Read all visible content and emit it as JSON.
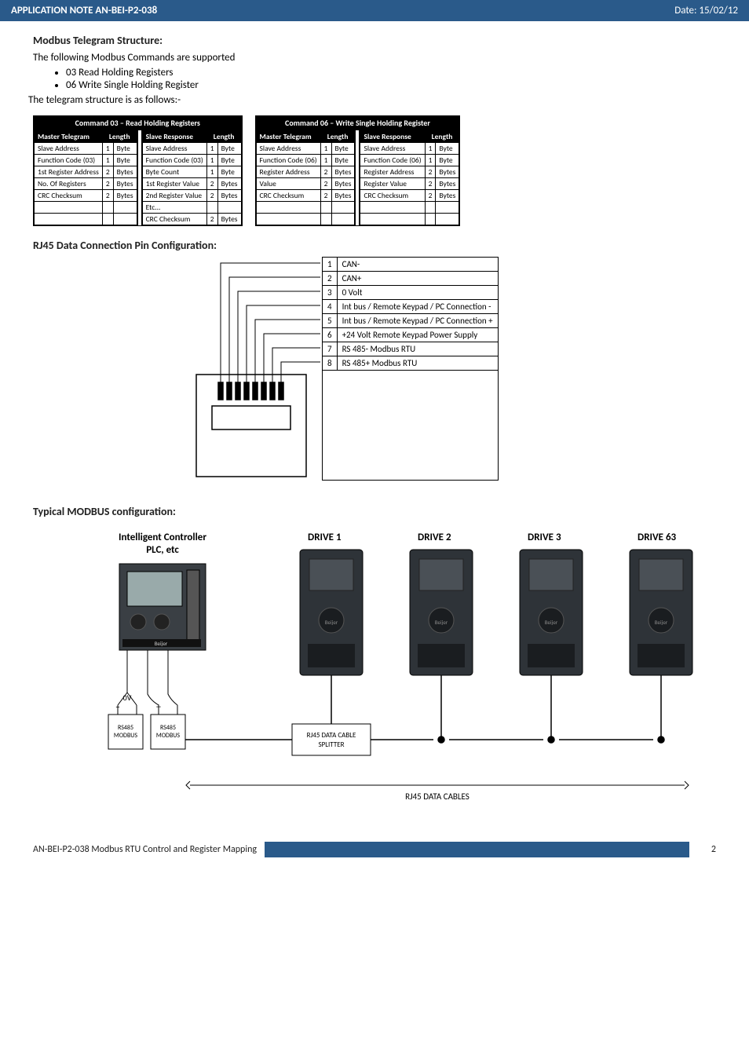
{
  "header": {
    "title": "APPLICATION NOTE AN-BEI-P2-038",
    "date": "Date: 15/02/12"
  },
  "sections": {
    "modbus_title": "Modbus Telegram Structure:",
    "modbus_intro": "The following Modbus Commands are supported",
    "bullets": [
      "03 Read Holding Registers",
      "06 Write Single Holding Register"
    ],
    "telegram_note": "The telegram structure is as follows:-",
    "rj45_title": "RJ45 Data Connection Pin Configuration:",
    "typical_title": "Typical MODBUS configuration:"
  },
  "cmd03": {
    "title": "Command 03 – Read Holding Registers",
    "master": {
      "head": [
        "Master Telegram",
        "Length"
      ],
      "rows": [
        [
          "Slave Address",
          "1",
          "Byte"
        ],
        [
          "Function Code (03)",
          "1",
          "Byte"
        ],
        [
          "1st Register Address",
          "2",
          "Bytes"
        ],
        [
          "No. Of Registers",
          "2",
          "Bytes"
        ],
        [
          "CRC Checksum",
          "2",
          "Bytes"
        ],
        [
          "",
          "",
          ""
        ],
        [
          "",
          "",
          ""
        ]
      ]
    },
    "slave": {
      "head": [
        "Slave Response",
        "Length"
      ],
      "rows": [
        [
          "Slave Address",
          "1",
          "Byte"
        ],
        [
          "Function Code (03)",
          "1",
          "Byte"
        ],
        [
          "Byte Count",
          "1",
          "Byte"
        ],
        [
          "1st Register Value",
          "2",
          "Bytes"
        ],
        [
          "2nd Register Value",
          "2",
          "Bytes"
        ],
        [
          "Etc...",
          "",
          ""
        ],
        [
          "CRC Checksum",
          "2",
          "Bytes"
        ]
      ]
    }
  },
  "cmd06": {
    "title": "Command 06 – Write Single Holding Register",
    "master": {
      "head": [
        "Master Telegram",
        "Length"
      ],
      "rows": [
        [
          "Slave Address",
          "1",
          "Byte"
        ],
        [
          "Function Code (06)",
          "1",
          "Byte"
        ],
        [
          "Register Address",
          "2",
          "Bytes"
        ],
        [
          "Value",
          "2",
          "Bytes"
        ],
        [
          "CRC Checksum",
          "2",
          "Bytes"
        ],
        [
          "",
          "",
          ""
        ],
        [
          "",
          "",
          ""
        ]
      ]
    },
    "slave": {
      "head": [
        "Slave Response",
        "Length"
      ],
      "rows": [
        [
          "Slave Address",
          "1",
          "Byte"
        ],
        [
          "Function Code (06)",
          "1",
          "Byte"
        ],
        [
          "Register Address",
          "2",
          "Bytes"
        ],
        [
          "Register Value",
          "2",
          "Bytes"
        ],
        [
          "CRC Checksum",
          "2",
          "Bytes"
        ],
        [
          "",
          "",
          ""
        ],
        [
          "",
          "",
          ""
        ]
      ]
    }
  },
  "rj45": {
    "pins": [
      {
        "n": "1",
        "label": "CAN-"
      },
      {
        "n": "2",
        "label": "CAN+"
      },
      {
        "n": "3",
        "label": "0 Volt"
      },
      {
        "n": "4",
        "label": "Int bus / Remote Keypad / PC Connection -"
      },
      {
        "n": "5",
        "label": "Int bus / Remote Keypad / PC Connection +"
      },
      {
        "n": "6",
        "label": "+24 Volt Remote Keypad Power Supply"
      },
      {
        "n": "7",
        "label": "RS 485- Modbus RTU"
      },
      {
        "n": "8",
        "label": "RS 485+ Modbus RTU"
      }
    ]
  },
  "diagram": {
    "controller_l1": "Intelligent Controller",
    "controller_l2": "PLC, etc",
    "drives": [
      "DRIVE 1",
      "DRIVE 2",
      "DRIVE 3",
      "DRIVE 63"
    ],
    "splitter": "RJ45 DATA CABLE\nSPLITTER",
    "cables": "RJ45 DATA CABLES",
    "rs485_left": "RS485\nMODBUS",
    "rs485_right": "RS485\nMODBUS",
    "ov": "0V",
    "plus": "+",
    "minus": "–"
  },
  "footer": {
    "text": "AN-BEI-P2-038 Modbus RTU Control and Register Mapping",
    "page": "2"
  }
}
